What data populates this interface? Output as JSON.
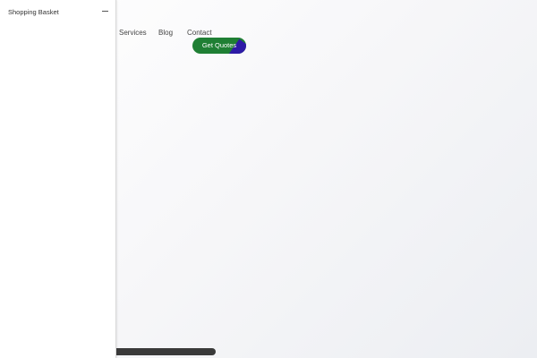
{
  "drawer": {
    "title": "Shopping Basket",
    "close_icon": "minus-close-icon"
  },
  "nav": {
    "items": [
      {
        "label": "Services"
      },
      {
        "label": "Blog"
      },
      {
        "label": "Contact"
      }
    ]
  },
  "cta": {
    "label": "Get Quotes",
    "color": "#1f7f34",
    "accent_color": "#2d1aa6"
  }
}
